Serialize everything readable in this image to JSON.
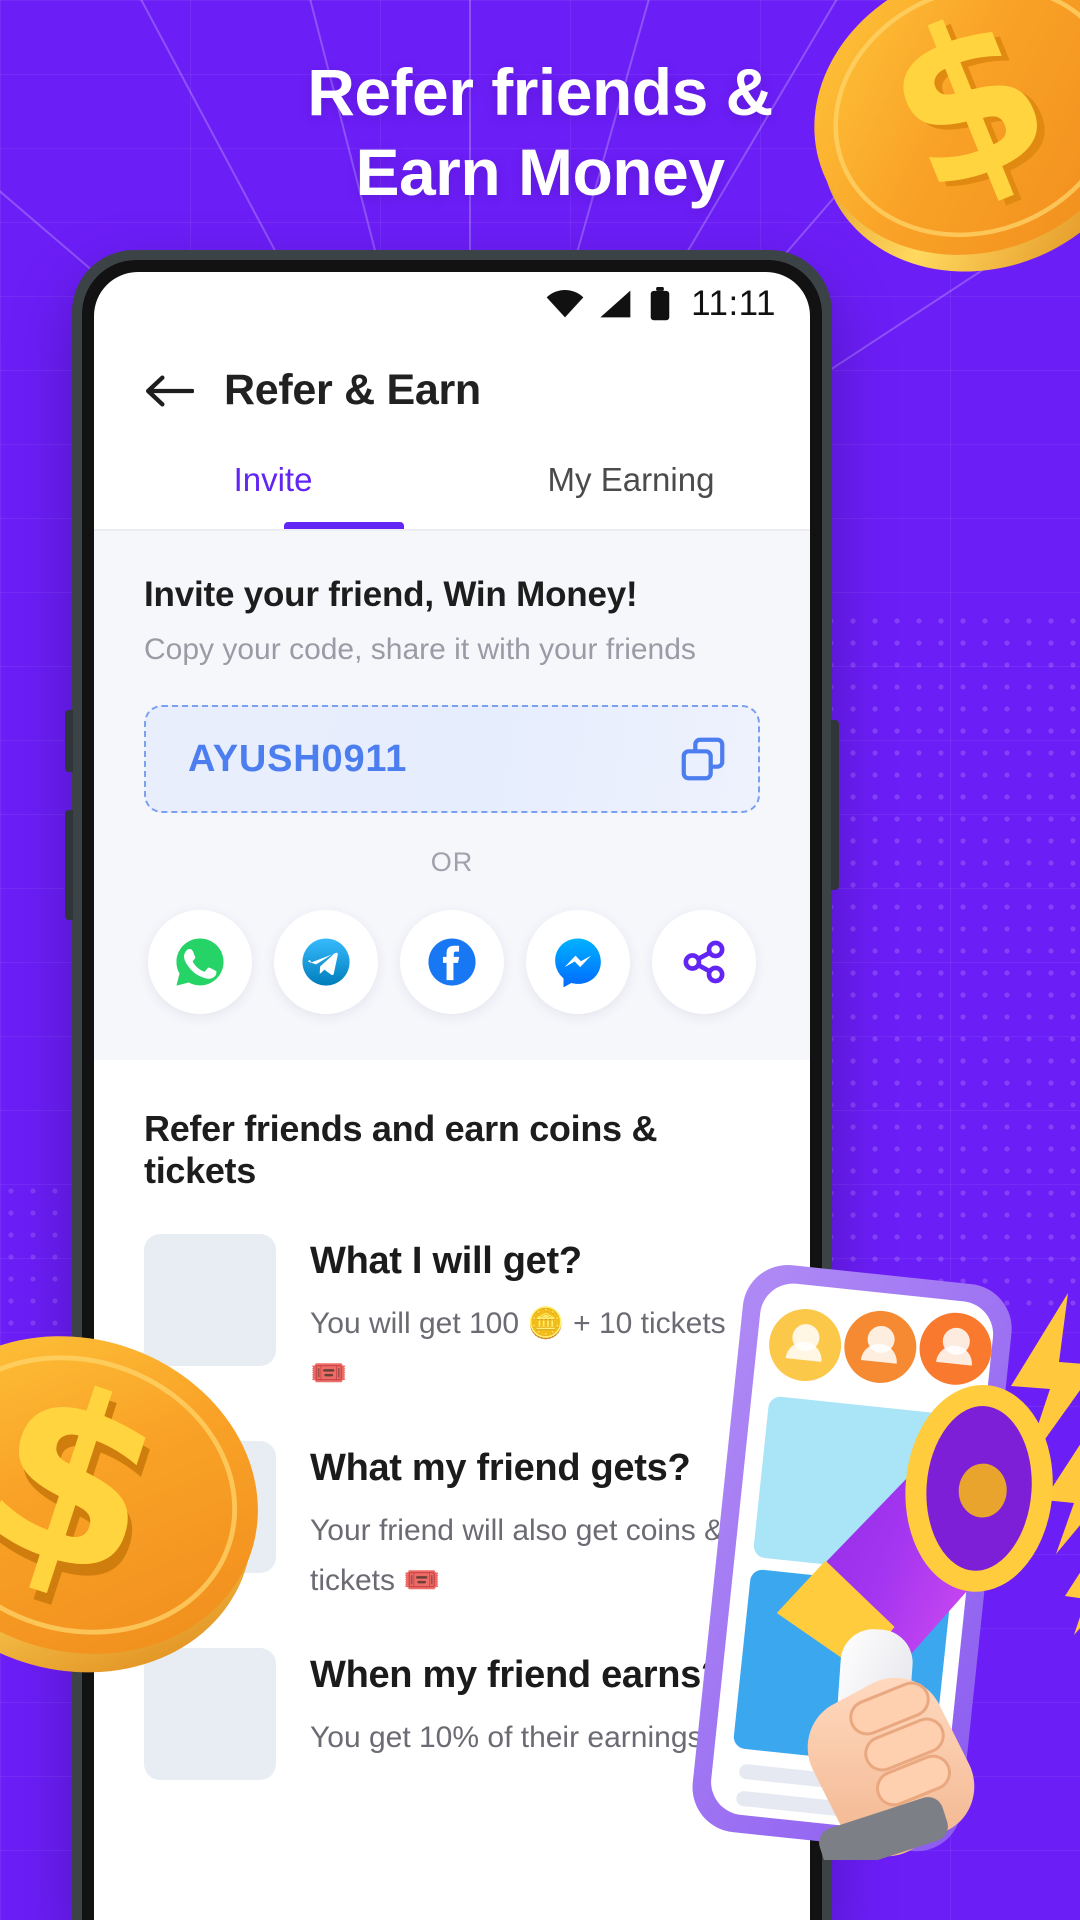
{
  "theme": {
    "background_purple": "#6c1ef6",
    "accent_purple": "#6225f4",
    "code_blue": "#4d7ef0",
    "coin_gold": "#f7a823"
  },
  "hero": {
    "line1": "Refer friends &",
    "line2": "Earn Money"
  },
  "statusbar": {
    "wifi_icon": "wifi-icon",
    "signal_icon": "cellular-signal-icon",
    "battery_icon": "battery-icon",
    "time": "11:11"
  },
  "appbar": {
    "back_icon": "back-arrow-icon",
    "title": "Refer & Earn"
  },
  "tabs": [
    {
      "label": "Invite",
      "active": true
    },
    {
      "label": "My Earning",
      "active": false
    }
  ],
  "invite": {
    "title": "Invite your friend, Win Money!",
    "subtitle": "Copy your code, share it with your friends",
    "code": "AYUSH0911",
    "copy_icon": "copy-icon",
    "or_label": "OR",
    "socials": [
      {
        "name": "whatsapp-icon",
        "label": "WhatsApp",
        "color": "#25D366"
      },
      {
        "name": "telegram-icon",
        "label": "Telegram",
        "color": "#2AABEE"
      },
      {
        "name": "facebook-icon",
        "label": "Facebook",
        "color": "#1877F2"
      },
      {
        "name": "messenger-icon",
        "label": "Messenger",
        "color": "#0099FF"
      },
      {
        "name": "share-icon",
        "label": "Share",
        "color": "#6225f4"
      }
    ]
  },
  "refer": {
    "heading": "Refer friends and earn coins & tickets",
    "items": [
      {
        "title": "What I will get?",
        "desc_before": "You will get 100 ",
        "coin_emoji": "🪙",
        "desc_mid": " + 10 tickets ",
        "ticket_emoji": "🎟️",
        "desc_after": ""
      },
      {
        "title": "What my friend gets?",
        "desc_before": "Your friend will also get coins & tickets ",
        "coin_emoji": "",
        "desc_mid": "",
        "ticket_emoji": "🎟️",
        "desc_after": ""
      },
      {
        "title": "When my friend earns?",
        "desc_before": "You get 10% of their earnings",
        "coin_emoji": "",
        "desc_mid": "",
        "ticket_emoji": "",
        "desc_after": ""
      }
    ]
  },
  "decorations": {
    "coin_top_right": "gold-coin-dollar-icon",
    "coin_bottom_left": "gold-coin-dollar-icon",
    "megaphone": "megaphone-illustration"
  }
}
